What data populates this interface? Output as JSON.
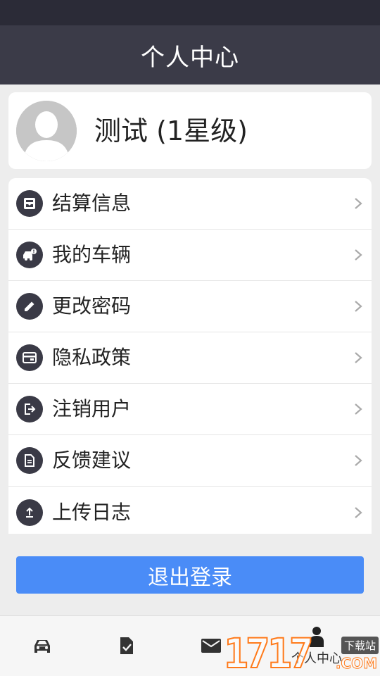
{
  "header": {
    "title": "个人中心"
  },
  "profile": {
    "name": "测试 (1星级)"
  },
  "menu": [
    {
      "label": "结算信息",
      "icon": "settlement-icon"
    },
    {
      "label": "我的车辆",
      "icon": "vehicle-icon"
    },
    {
      "label": "更改密码",
      "icon": "pencil-icon"
    },
    {
      "label": "隐私政策",
      "icon": "card-icon"
    },
    {
      "label": "注销用户",
      "icon": "exit-icon"
    },
    {
      "label": "反馈建议",
      "icon": "document-icon"
    },
    {
      "label": "上传日志",
      "icon": "upload-icon"
    }
  ],
  "logout": {
    "label": "退出登录"
  },
  "tabs": [
    {
      "icon": "car-icon",
      "label": ""
    },
    {
      "icon": "task-check-icon",
      "label": ""
    },
    {
      "icon": "mail-icon",
      "label": ""
    },
    {
      "icon": "person-icon",
      "label": "个人中心"
    }
  ],
  "watermark": {
    "text": "1717",
    "badge": "下载站",
    "suffix": ".COM"
  },
  "colors": {
    "header": "#3b3b48",
    "status_bar": "#2b2b37",
    "accent": "#4a8cf7",
    "icon_bg": "#3a3a46"
  }
}
